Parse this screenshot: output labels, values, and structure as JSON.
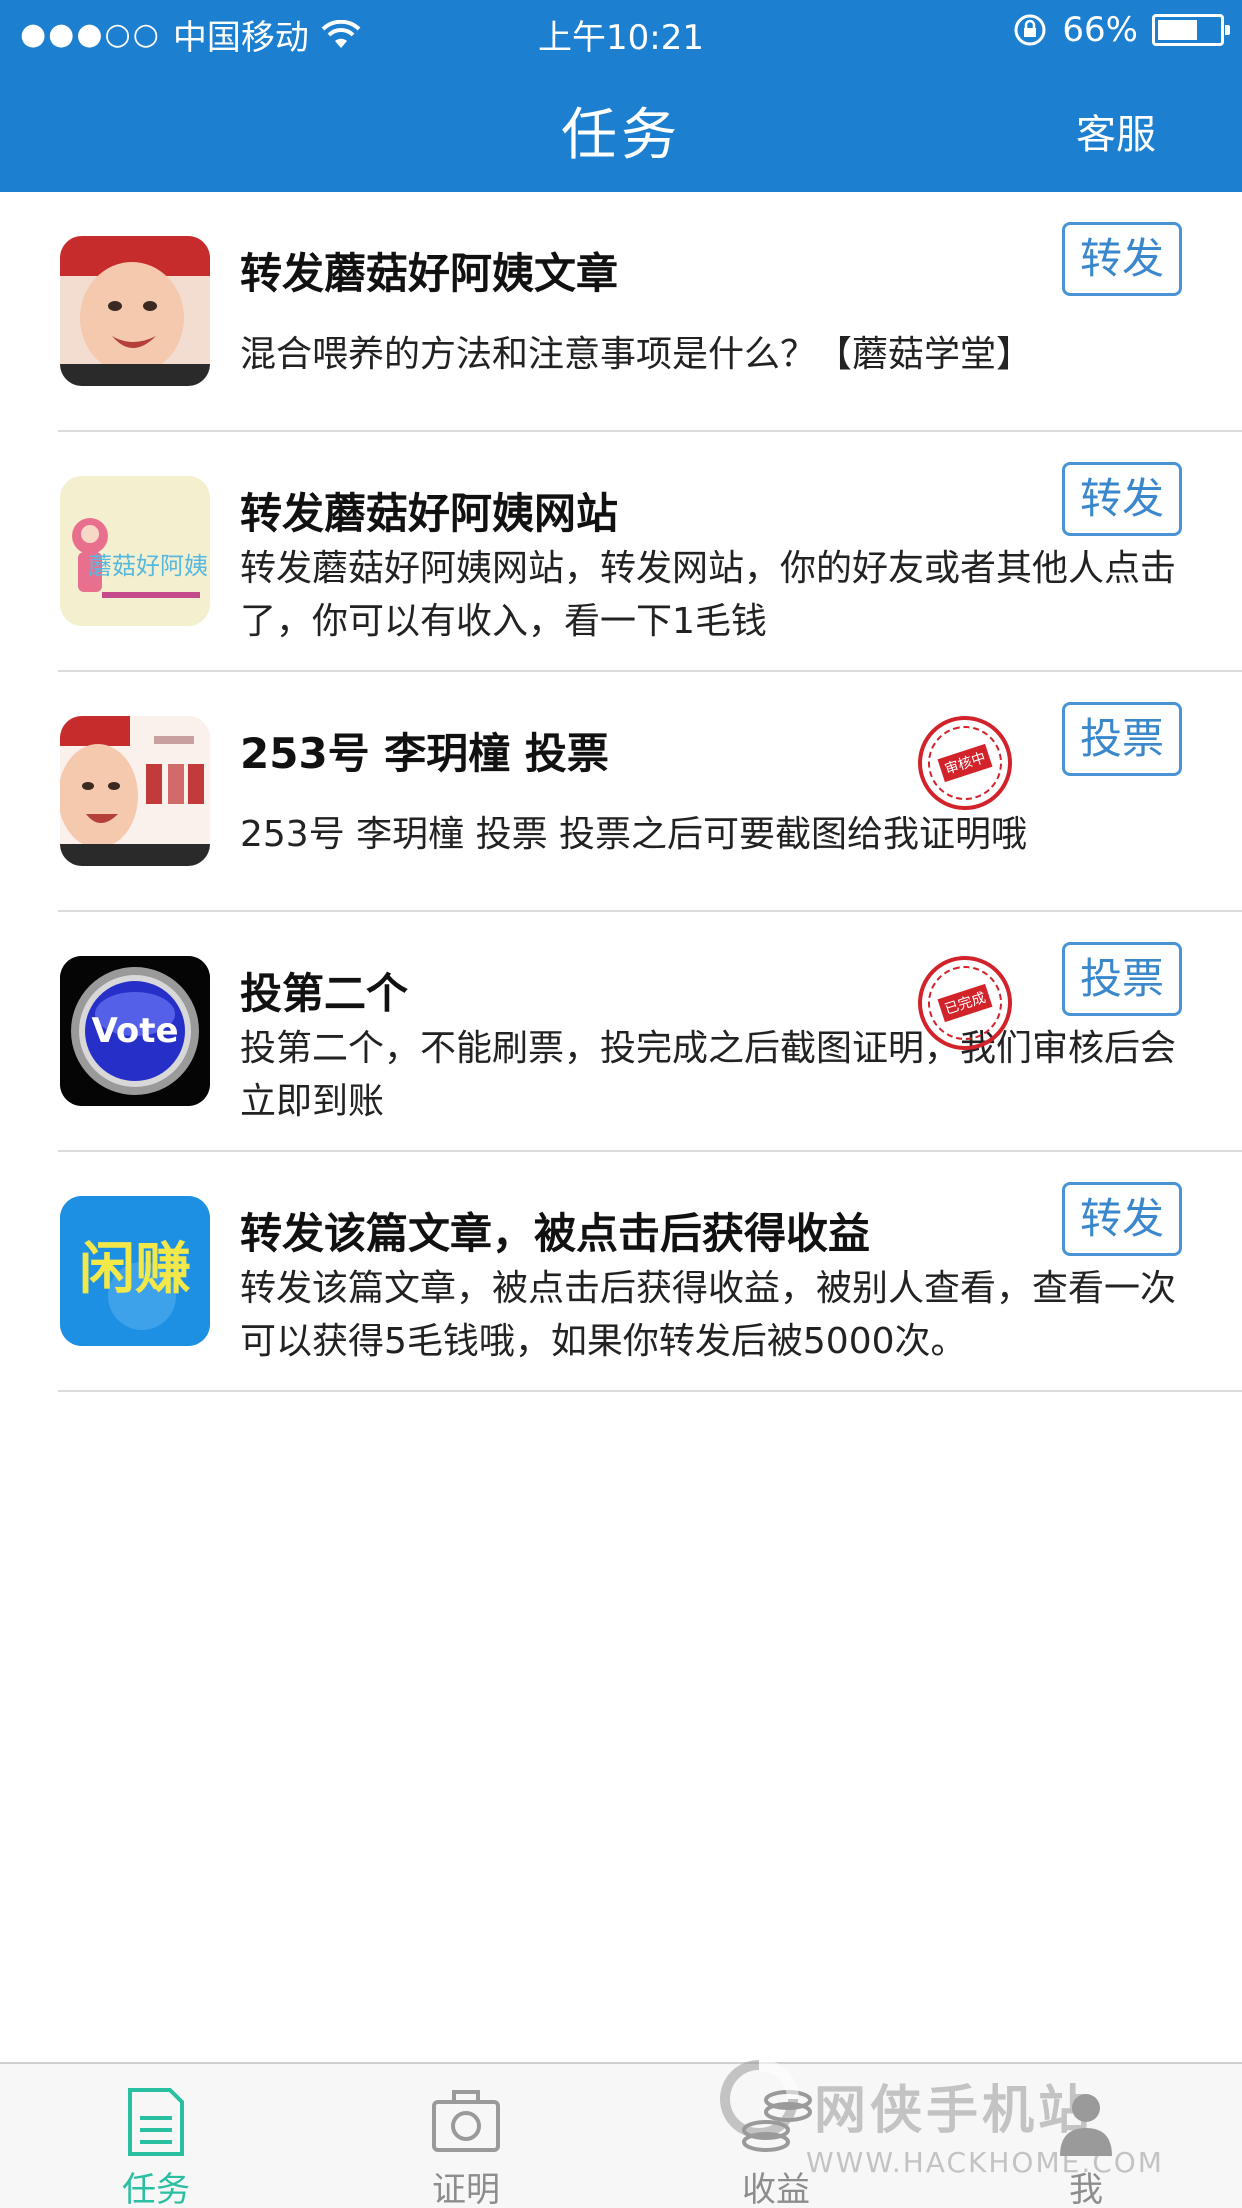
{
  "status_bar": {
    "signal": "●●●○○",
    "carrier": "中国移动",
    "time": "上午10:21",
    "battery": "66%",
    "battery_level": 0.66
  },
  "nav": {
    "title": "任务",
    "action": "客服"
  },
  "tasks": [
    {
      "title": "转发蘑菇好阿姨文章",
      "description": "混合喂养的方法和注意事项是什么？【蘑菇学堂】",
      "button": "转发",
      "thumb": "baby-photo"
    },
    {
      "title": "转发蘑菇好阿姨网站",
      "description": "转发蘑菇好阿姨网站，转发网站，你的好友或者其他人点击了，你可以有收入，看一下1毛钱",
      "button": "转发",
      "thumb": "mogu-logo",
      "thumb_text": "蘑菇好阿姨"
    },
    {
      "title": "253号 李玥橦 投票",
      "description": "253号 李玥橦 投票 投票之后可要截图给我证明哦",
      "button": "投票",
      "thumb": "baby-vote-photo",
      "stamp": "审核中"
    },
    {
      "title": "投第二个",
      "description": "投第二个，不能刷票，投完成之后截图证明，我们审核后会立即到账",
      "button": "投票",
      "thumb": "vote-button",
      "thumb_text": "Vote",
      "stamp": "已完成"
    },
    {
      "title": "转发该篇文章，被点击后获得收益",
      "description": "转发该篇文章，被点击后获得收益，被别人查看，查看一次可以获得5毛钱哦，如果你转发后被5000次。",
      "button": "转发",
      "thumb": "xianzhuan-logo",
      "thumb_text": "闲赚"
    }
  ],
  "tabs": [
    {
      "label": "任务",
      "icon": "document-icon",
      "active": true
    },
    {
      "label": "证明",
      "icon": "camera-icon",
      "active": false
    },
    {
      "label": "收益",
      "icon": "coins-icon",
      "active": false
    },
    {
      "label": "我",
      "icon": "person-icon",
      "active": false
    }
  ],
  "watermark": {
    "title": "网侠手机站",
    "url": "WWW.HACKHOME.COM"
  },
  "colors": {
    "header": "#1c7fd0",
    "button_border": "#4a93d4",
    "tab_active": "#2bbfa1",
    "stamp": "#d2232a"
  }
}
